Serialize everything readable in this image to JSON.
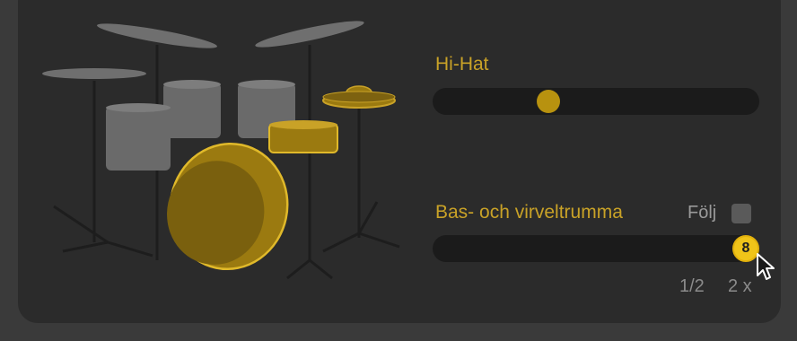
{
  "hihat": {
    "label": "Hi-Hat",
    "value": 0.34
  },
  "bass_snare": {
    "label": "Bas- och virveltrumma",
    "follow_label": "Följ",
    "follow_checked": false,
    "value": 1.0,
    "badge": "8",
    "ticks": [
      "1/2",
      "2 x"
    ]
  },
  "colors": {
    "accent": "#c9a227",
    "highlight_drum": "#9b7a10",
    "inactive_drum": "#6f6f6f",
    "panel": "#2b2b2b",
    "background": "#3a3a3a"
  }
}
